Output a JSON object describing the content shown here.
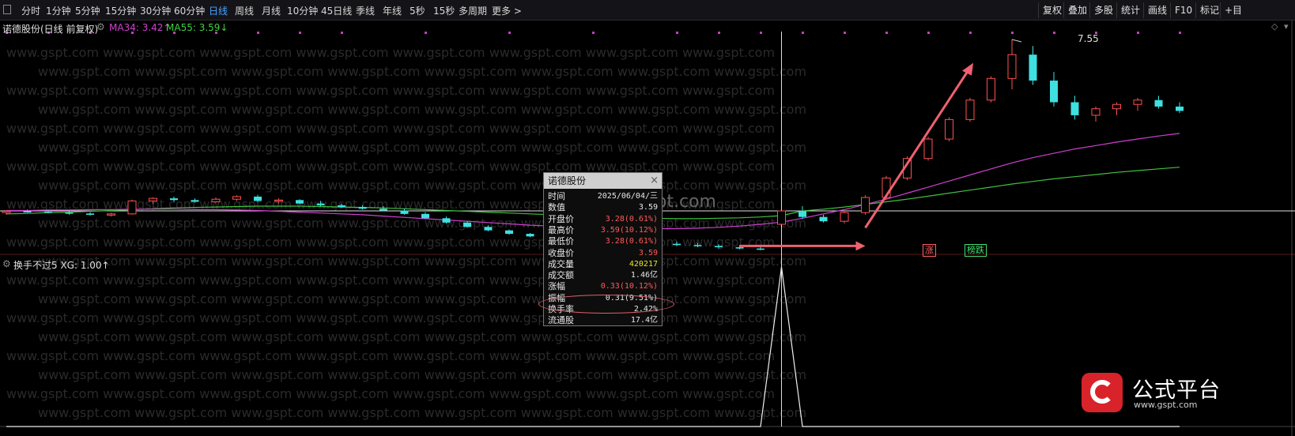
{
  "toolbar": {
    "tabs": [
      "分时",
      "1分钟",
      "5分钟",
      "15分钟",
      "30分钟",
      "60分钟",
      "日线",
      "周线",
      "月线",
      "10分钟",
      "45日线",
      "季线",
      "年线",
      "5秒",
      "15秒",
      "多周期",
      "更多 >"
    ],
    "active_tab": "日线",
    "right_buttons": [
      "复权",
      "叠加",
      "多股",
      "统计",
      "画线",
      "F10",
      "标记",
      "+目"
    ]
  },
  "main_chart": {
    "stock_name": "诺德股份(日线 前复权)",
    "ma34_label": "MA34: 3.42↑",
    "ma55_label": "MA55: 3.59↓",
    "high_label": "7.55",
    "signals": [
      {
        "text": "涨",
        "color": "#f0b040",
        "day": 30
      },
      {
        "text": "涨",
        "color": "#ff6060",
        "day": 44
      },
      {
        "text": "榜跌",
        "color": "#40e070",
        "day": 46
      }
    ]
  },
  "sub_chart": {
    "indicator_label": "换手不过5 XG: 1.00↑"
  },
  "tooltip": {
    "title": "诺德股份",
    "close": "×",
    "rows": [
      {
        "label": "时间",
        "value": "2025/06/04/三",
        "color": "#e8e8e8"
      },
      {
        "label": "数值",
        "value": "3.59",
        "color": "#e8e8e8"
      },
      {
        "label": "开盘价",
        "value": "3.28(0.61%)",
        "color": "#ff5a5a"
      },
      {
        "label": "最高价",
        "value": "3.59(10.12%)",
        "color": "#ff5a5a"
      },
      {
        "label": "最低价",
        "value": "3.28(0.61%)",
        "color": "#ff5a5a"
      },
      {
        "label": "收盘价",
        "value": "3.59",
        "color": "#ff5a5a"
      },
      {
        "label": "成交量",
        "value": "420217",
        "color": "#e8e820"
      },
      {
        "label": "成交额",
        "value": "1.46亿",
        "color": "#e8e8e8"
      },
      {
        "label": "涨幅",
        "value": "0.33(10.12%)",
        "color": "#ff5a5a"
      },
      {
        "label": "振幅",
        "value": "0.31(9.51%)",
        "color": "#e8e8e8"
      },
      {
        "label": "换手率",
        "value": "2.42%",
        "color": "#e8e8e8"
      },
      {
        "label": "流通股",
        "value": "17.4亿",
        "color": "#e8e8e8"
      }
    ]
  },
  "watermark": "www.gspt.com",
  "logo": {
    "title": "公式平台",
    "url": "www.gspt.com"
  },
  "colors": {
    "up": "#ff5050",
    "down": "#3ee0e0",
    "ma34": "#d040d0",
    "ma55": "#40c040",
    "grid": "#5a1a1a",
    "crosshair": "#e0e0e0"
  },
  "chart_data": {
    "type": "candlestick",
    "price_reference": 3.59,
    "high_point": 7.55,
    "candles_ohlc": [
      [
        3.55,
        3.6,
        3.5,
        3.58
      ],
      [
        3.58,
        3.62,
        3.55,
        3.57
      ],
      [
        3.57,
        3.6,
        3.53,
        3.55
      ],
      [
        3.55,
        3.59,
        3.5,
        3.53
      ],
      [
        3.53,
        3.56,
        3.48,
        3.5
      ],
      [
        3.5,
        3.55,
        3.46,
        3.52
      ],
      [
        3.52,
        3.85,
        3.5,
        3.82
      ],
      [
        3.82,
        3.9,
        3.75,
        3.88
      ],
      [
        3.88,
        3.92,
        3.8,
        3.84
      ],
      [
        3.84,
        3.88,
        3.78,
        3.8
      ],
      [
        3.8,
        3.9,
        3.78,
        3.86
      ],
      [
        3.86,
        3.95,
        3.82,
        3.92
      ],
      [
        3.92,
        3.96,
        3.8,
        3.82
      ],
      [
        3.82,
        3.88,
        3.76,
        3.84
      ],
      [
        3.84,
        3.86,
        3.74,
        3.76
      ],
      [
        3.76,
        3.82,
        3.7,
        3.72
      ],
      [
        3.72,
        3.76,
        3.66,
        3.68
      ],
      [
        3.68,
        3.72,
        3.62,
        3.64
      ],
      [
        3.64,
        3.7,
        3.58,
        3.6
      ],
      [
        3.6,
        3.64,
        3.5,
        3.52
      ],
      [
        3.52,
        3.56,
        3.4,
        3.42
      ],
      [
        3.42,
        3.46,
        3.3,
        3.32
      ],
      [
        3.32,
        3.36,
        3.2,
        3.22
      ],
      [
        3.22,
        3.26,
        3.12,
        3.14
      ],
      [
        3.14,
        3.16,
        3.04,
        3.06
      ],
      [
        3.06,
        3.08,
        2.98,
        3.0
      ],
      [
        3.0,
        3.04,
        2.94,
        2.96
      ],
      [
        2.96,
        3.0,
        2.9,
        2.93
      ],
      [
        2.93,
        2.98,
        2.87,
        2.9
      ],
      [
        2.9,
        2.95,
        2.85,
        2.88
      ],
      [
        2.88,
        2.92,
        2.82,
        2.85
      ],
      [
        2.85,
        2.9,
        2.8,
        2.83
      ],
      [
        2.83,
        2.88,
        2.78,
        2.8
      ],
      [
        2.8,
        2.85,
        2.75,
        2.78
      ],
      [
        2.78,
        2.82,
        2.72,
        2.75
      ],
      [
        2.75,
        2.8,
        2.7,
        2.72
      ],
      [
        2.72,
        2.78,
        2.68,
        2.7
      ],
      [
        3.28,
        3.59,
        3.28,
        3.59
      ],
      [
        3.59,
        3.7,
        3.4,
        3.45
      ],
      [
        3.45,
        3.5,
        3.32,
        3.35
      ],
      [
        3.35,
        3.6,
        3.3,
        3.55
      ],
      [
        3.55,
        3.95,
        3.5,
        3.9
      ],
      [
        3.9,
        4.4,
        3.85,
        4.35
      ],
      [
        4.35,
        4.85,
        4.3,
        4.8
      ],
      [
        4.8,
        5.3,
        4.75,
        5.25
      ],
      [
        5.25,
        5.75,
        5.2,
        5.7
      ],
      [
        5.7,
        6.2,
        5.65,
        6.15
      ],
      [
        6.15,
        6.7,
        6.1,
        6.65
      ],
      [
        6.65,
        7.55,
        6.4,
        7.2
      ],
      [
        7.2,
        7.4,
        6.5,
        6.6
      ],
      [
        6.6,
        6.8,
        6.0,
        6.1
      ],
      [
        6.1,
        6.25,
        5.7,
        5.8
      ],
      [
        5.8,
        6.0,
        5.65,
        5.95
      ],
      [
        5.95,
        6.1,
        5.8,
        6.05
      ],
      [
        6.05,
        6.2,
        5.9,
        6.15
      ],
      [
        6.15,
        6.25,
        5.95,
        6.0
      ],
      [
        6.0,
        6.1,
        5.85,
        5.9
      ]
    ],
    "ma34": [
      3.6,
      3.6,
      3.61,
      3.61,
      3.62,
      3.62,
      3.63,
      3.63,
      3.63,
      3.62,
      3.62,
      3.61,
      3.6,
      3.58,
      3.56,
      3.54,
      3.52,
      3.5,
      3.47,
      3.44,
      3.41,
      3.38,
      3.35,
      3.32,
      3.29,
      3.26,
      3.24,
      3.22,
      3.2,
      3.19,
      3.18,
      3.18,
      3.18,
      3.19,
      3.21,
      3.24,
      3.28,
      3.33,
      3.42,
      3.52,
      3.62,
      3.74,
      3.86,
      4.0,
      4.14,
      4.28,
      4.42,
      4.56,
      4.7,
      4.82,
      4.92,
      5.02,
      5.1,
      5.18,
      5.25,
      5.32,
      5.38
    ],
    "ma55": [
      3.52,
      3.53,
      3.55,
      3.56,
      3.58,
      3.6,
      3.62,
      3.64,
      3.66,
      3.67,
      3.68,
      3.69,
      3.7,
      3.7,
      3.7,
      3.69,
      3.68,
      3.67,
      3.66,
      3.64,
      3.62,
      3.6,
      3.58,
      3.56,
      3.54,
      3.52,
      3.5,
      3.48,
      3.46,
      3.44,
      3.43,
      3.42,
      3.41,
      3.41,
      3.42,
      3.43,
      3.45,
      3.48,
      3.59,
      3.63,
      3.68,
      3.74,
      3.8,
      3.86,
      3.93,
      4.0,
      4.07,
      4.14,
      4.21,
      4.27,
      4.33,
      4.38,
      4.43,
      4.48,
      4.52,
      4.56,
      4.6
    ],
    "indicator_xg": {
      "series": [
        0,
        0,
        0,
        0,
        0,
        0,
        0,
        0,
        0,
        0,
        0,
        0,
        0,
        0,
        0,
        0,
        0,
        0,
        0,
        0,
        0,
        0,
        0,
        0,
        0,
        0,
        0,
        0,
        0,
        0,
        0,
        0,
        0,
        0,
        0,
        0,
        0,
        1,
        0,
        0,
        0,
        0,
        0,
        0,
        0,
        0,
        0,
        0,
        0,
        0,
        0,
        0,
        0,
        0,
        0,
        0,
        0
      ],
      "value": 1.0
    }
  }
}
